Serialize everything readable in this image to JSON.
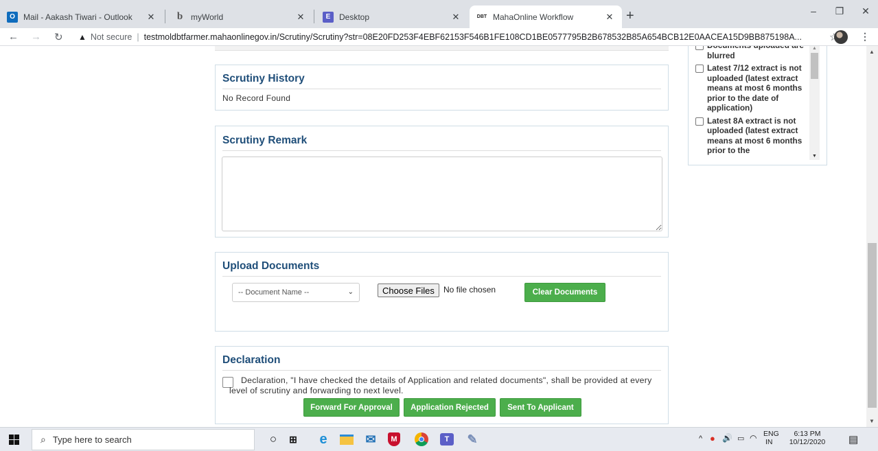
{
  "browser": {
    "tabs": [
      {
        "title": "Mail - Aakash Tiwari - Outlook",
        "icon": "outlook-icon",
        "color": "#0f6cbd"
      },
      {
        "title": "myWorld",
        "icon": "myworld-icon",
        "color": "#555555"
      },
      {
        "title": "Desktop",
        "icon": "desktop-icon",
        "color": "#5b5fc7"
      },
      {
        "title": "MahaOnline Workflow",
        "icon": "dbt-icon",
        "color": "#222222"
      }
    ],
    "new_tab": "+",
    "window_controls": [
      "–",
      "❐",
      "✕"
    ],
    "address": {
      "security": "Not secure",
      "url": "testmoldbtfarmer.mahaonlinegov.in/Scrutiny/Scrutiny?str=08E20FD253F4EBF62153F546B1FE108CD1BE0577795B2B678532B85A654BCB12E0AACEA15D9BB875198A..."
    }
  },
  "page": {
    "scrutiny_history": {
      "title": "Scrutiny History",
      "empty_text": "No Record Found"
    },
    "scrutiny_remark": {
      "title": "Scrutiny Remark",
      "value": ""
    },
    "upload_documents": {
      "title": "Upload Documents",
      "document_select": "-- Document Name --",
      "choose_files": "Choose Files",
      "no_file": "No file chosen",
      "clear_button": "Clear Documents"
    },
    "declaration": {
      "title": "Declaration",
      "text": "Declaration, \"I have checked the details of Application and related documents\", shall be provided at every level of scrutiny and forwarding to next level.",
      "buttons": {
        "forward": "Forward For Approval",
        "rejected": "Application Rejected",
        "sent": "Sent To Applicant"
      }
    },
    "checklist": [
      "Documents uploaded are blurred",
      "Latest 7/12 extract is not uploaded (latest extract means at most 6 months prior to the date of application)",
      "Latest 8A extract is not uploaded (latest extract means at most 6 months prior to the"
    ]
  },
  "taskbar": {
    "search_placeholder": "Type here to search",
    "tray": {
      "lang": "ENG",
      "region": "IN",
      "time": "6:13 PM",
      "date": "10/12/2020"
    }
  }
}
